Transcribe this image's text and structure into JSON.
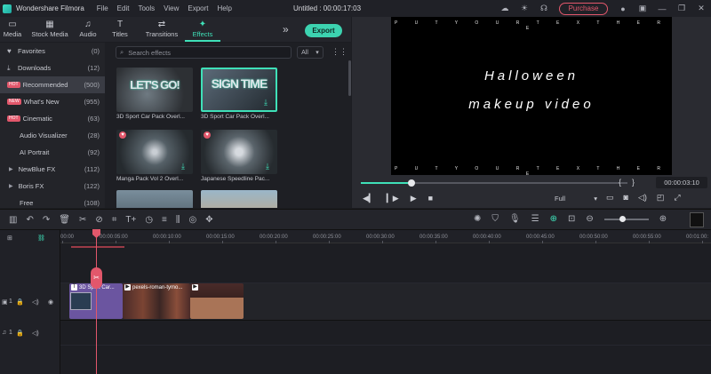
{
  "titlebar": {
    "app_name": "Wondershare Filmora",
    "menu": [
      "File",
      "Edit",
      "Tools",
      "View",
      "Export",
      "Help"
    ],
    "document_title": "Untitled : 00:00:17:03",
    "purchase_label": "Purchase"
  },
  "top_tabs": [
    {
      "label": "Media",
      "icon": "media-icon"
    },
    {
      "label": "Stock Media",
      "icon": "stock-media-icon"
    },
    {
      "label": "Audio",
      "icon": "audio-icon"
    },
    {
      "label": "Titles",
      "icon": "titles-icon"
    },
    {
      "label": "Transitions",
      "icon": "transitions-icon"
    },
    {
      "label": "Effects",
      "icon": "effects-icon",
      "active": true
    }
  ],
  "export_label": "Export",
  "sidebar": {
    "items": [
      {
        "label": "Favorites",
        "count": "(0)",
        "icon": "heart-icon"
      },
      {
        "label": "Downloads",
        "count": "(12)",
        "icon": "download-icon"
      },
      {
        "label": "Recommended",
        "count": "(500)",
        "badge": "HOT",
        "active": true
      },
      {
        "label": "What's New",
        "count": "(955)",
        "badge": "NEW"
      },
      {
        "label": "Cinematic",
        "count": "(63)",
        "badge": "HOT"
      },
      {
        "label": "Audio Visualizer",
        "count": "(28)"
      },
      {
        "label": "AI Portrait",
        "count": "(92)"
      },
      {
        "label": "NewBlue FX",
        "count": "(112)",
        "expandable": true
      },
      {
        "label": "Boris FX",
        "count": "(122)",
        "expandable": true
      },
      {
        "label": "Free",
        "count": "(108)"
      }
    ]
  },
  "effects": {
    "search_placeholder": "Search effects",
    "filter_value": "All",
    "thumbnails": [
      {
        "label": "3D Sport Car Pack Overl...",
        "overlay_text": "LET'S GO!"
      },
      {
        "label": "3D Sport Car Pack Overl...",
        "overlay_text": "SIGN TIME",
        "selected": true
      },
      {
        "label": "Manga Pack Vol 2 Overl..."
      },
      {
        "label": "Japanese Speedline Pac..."
      },
      {
        "label": ""
      },
      {
        "label": ""
      }
    ]
  },
  "preview": {
    "top_text": "P U T   Y O U R   T E X T   H E R E",
    "line1": "Halloween",
    "line2": "makeup video",
    "bottom_text": "P U T   Y O U R   T E X T   H E R E",
    "timecode": "00:00:03:10",
    "quality": "Full",
    "progress": 0.19
  },
  "timeline": {
    "ruler_ticks": [
      "00:00",
      "00:00:05:00",
      "00:00:10:00",
      "00:00:15:00",
      "00:00:20:00",
      "00:00:25:00",
      "00:00:30:00",
      "00:00:35:00",
      "00:00:40:00",
      "00:00:45:00",
      "00:00:50:00",
      "00:00:55:00",
      "00:01:00:"
    ],
    "zoom_level": 0.4,
    "clips": {
      "effect": "3D Sport Car...",
      "video1": "pexels-roman-tymo...",
      "video2": ""
    },
    "track_labels": {
      "video": "1",
      "audio": "1"
    }
  }
}
